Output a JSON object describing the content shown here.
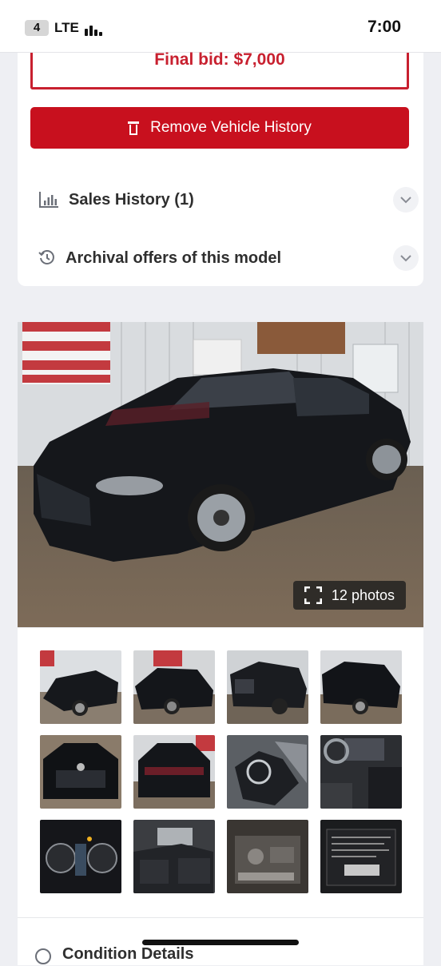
{
  "status_bar": {
    "sim": "4",
    "network": "LTE",
    "time": "7:00"
  },
  "auction": {
    "final_bid": "Final bid: $7,000"
  },
  "actions": {
    "remove_history": "Remove Vehicle History"
  },
  "accordions": [
    {
      "label": "Sales History (1)",
      "icon": "bar-chart-icon"
    },
    {
      "label": "Archival offers of this model",
      "icon": "history-icon"
    }
  ],
  "gallery": {
    "photos_label": "12 photos",
    "thumbnail_count": 12
  },
  "sections": {
    "condition": "Condition Details"
  },
  "colors": {
    "accent": "#c8101e",
    "background": "#eeeff3"
  }
}
